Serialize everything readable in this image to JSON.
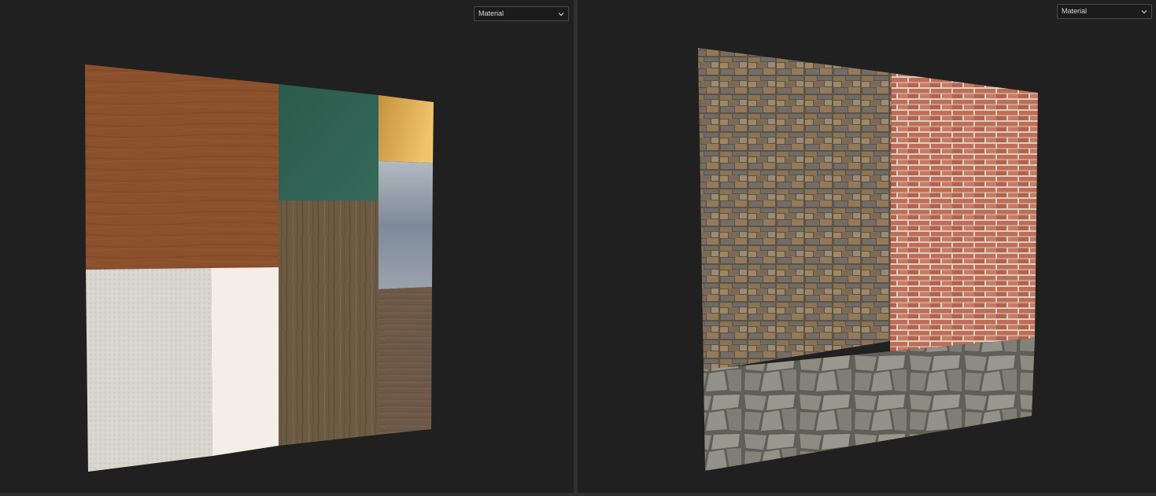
{
  "viewports": [
    {
      "id": "left",
      "display_mode": {
        "selected": "Material"
      },
      "tiles": [
        {
          "name": "wood-veneer",
          "color": "#8a4f2c"
        },
        {
          "name": "green-painted-wood",
          "color": "#2f5e4e"
        },
        {
          "name": "gold-metal",
          "color": "#d9a74e"
        },
        {
          "name": "blue-grey-marble",
          "color": "#8c98a6"
        },
        {
          "name": "weathered-wood-planks",
          "color": "#6d5c45"
        },
        {
          "name": "worn-floor-wood",
          "color": "#6e5a48"
        },
        {
          "name": "white-plaster",
          "color": "#d9d6d0"
        },
        {
          "name": "white-matte",
          "color": "#f4eee8"
        }
      ]
    },
    {
      "id": "right",
      "display_mode": {
        "selected": "Material"
      },
      "tiles": [
        {
          "name": "stone-wall",
          "color": "#7d6a50"
        },
        {
          "name": "red-brick",
          "color": "#b96a54"
        },
        {
          "name": "flagstone",
          "color": "#86857c"
        }
      ]
    }
  ]
}
